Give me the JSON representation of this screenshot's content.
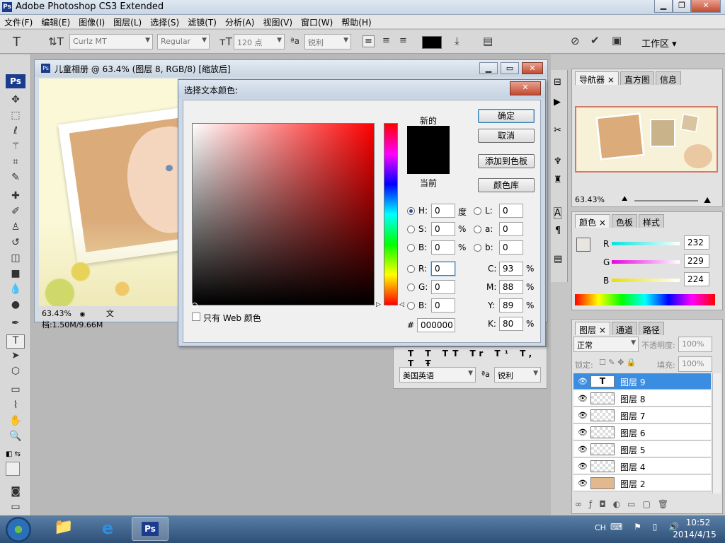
{
  "app": {
    "title": "Adobe Photoshop CS3 Extended"
  },
  "menu": [
    "文件(F)",
    "编辑(E)",
    "图像(I)",
    "图层(L)",
    "选择(S)",
    "滤镜(T)",
    "分析(A)",
    "视图(V)",
    "窗口(W)",
    "帮助(H)"
  ],
  "options": {
    "font_family": "Curlz MT",
    "font_style": "Regular",
    "font_size": "120 点",
    "aa_method": "锐利",
    "workspace": "工作区 ▾"
  },
  "document": {
    "title": "儿童相册 @ 63.4% (图层 8, RGB/8) [缩放后]",
    "zoom": "63.43%",
    "doc_info": "文档:1.50M/9.66M"
  },
  "color_dialog": {
    "title": "选择文本颜色:",
    "new_label": "新的",
    "current_label": "当前",
    "ok": "确定",
    "cancel": "取消",
    "add_swatch": "添加到色板",
    "color_lib": "颜色库",
    "h_label": "H:",
    "h_val": "0",
    "h_unit": "度",
    "s_label": "S:",
    "s_val": "0",
    "s_unit": "%",
    "b_label": "B:",
    "b_val": "0",
    "b_unit": "%",
    "r_label": "R:",
    "r_val": "0",
    "g_label": "G:",
    "g_val": "0",
    "blue_label": "B:",
    "blue_val": "0",
    "l_label": "L:",
    "l_val": "0",
    "a_label": "a:",
    "a_val": "0",
    "lab_b_label": "b:",
    "lab_b_val": "0",
    "c_label": "C:",
    "c_val": "93",
    "m_label": "M:",
    "m_val": "88",
    "y_label": "Y:",
    "y_val": "89",
    "k_label": "K:",
    "k_val": "80",
    "pct": "%",
    "hex_label": "#",
    "hex_val": "000000",
    "web_only": "只有 Web 颜色",
    "new_color": "#000000",
    "current_color": "#000000"
  },
  "char_panel": {
    "language": "美国英语",
    "aa": "锐利"
  },
  "navigator": {
    "tabs": [
      "导航器",
      "直方图",
      "信息"
    ],
    "zoom": "63.43%"
  },
  "color_panel": {
    "tabs": [
      "颜色",
      "色板",
      "样式"
    ],
    "r_label": "R",
    "r": "232",
    "g_label": "G",
    "g": "229",
    "b_label": "B",
    "b": "224"
  },
  "layers": {
    "tabs": [
      "图层",
      "通道",
      "路径"
    ],
    "blend": "正常",
    "opacity_label": "不透明度:",
    "opacity": "100%",
    "lock_label": "锁定:",
    "fill_label": "填充:",
    "fill": "100%",
    "items": [
      "图层 9",
      "图层 8",
      "图层 7",
      "图层 6",
      "图层 5",
      "图层 4",
      "图层 2"
    ]
  },
  "taskbar": {
    "ime": "CH",
    "time": "10:52",
    "date": "2014/4/15"
  },
  "colors": {
    "accent": "#1d4f9a",
    "selected_layer": "#3a8de0"
  }
}
